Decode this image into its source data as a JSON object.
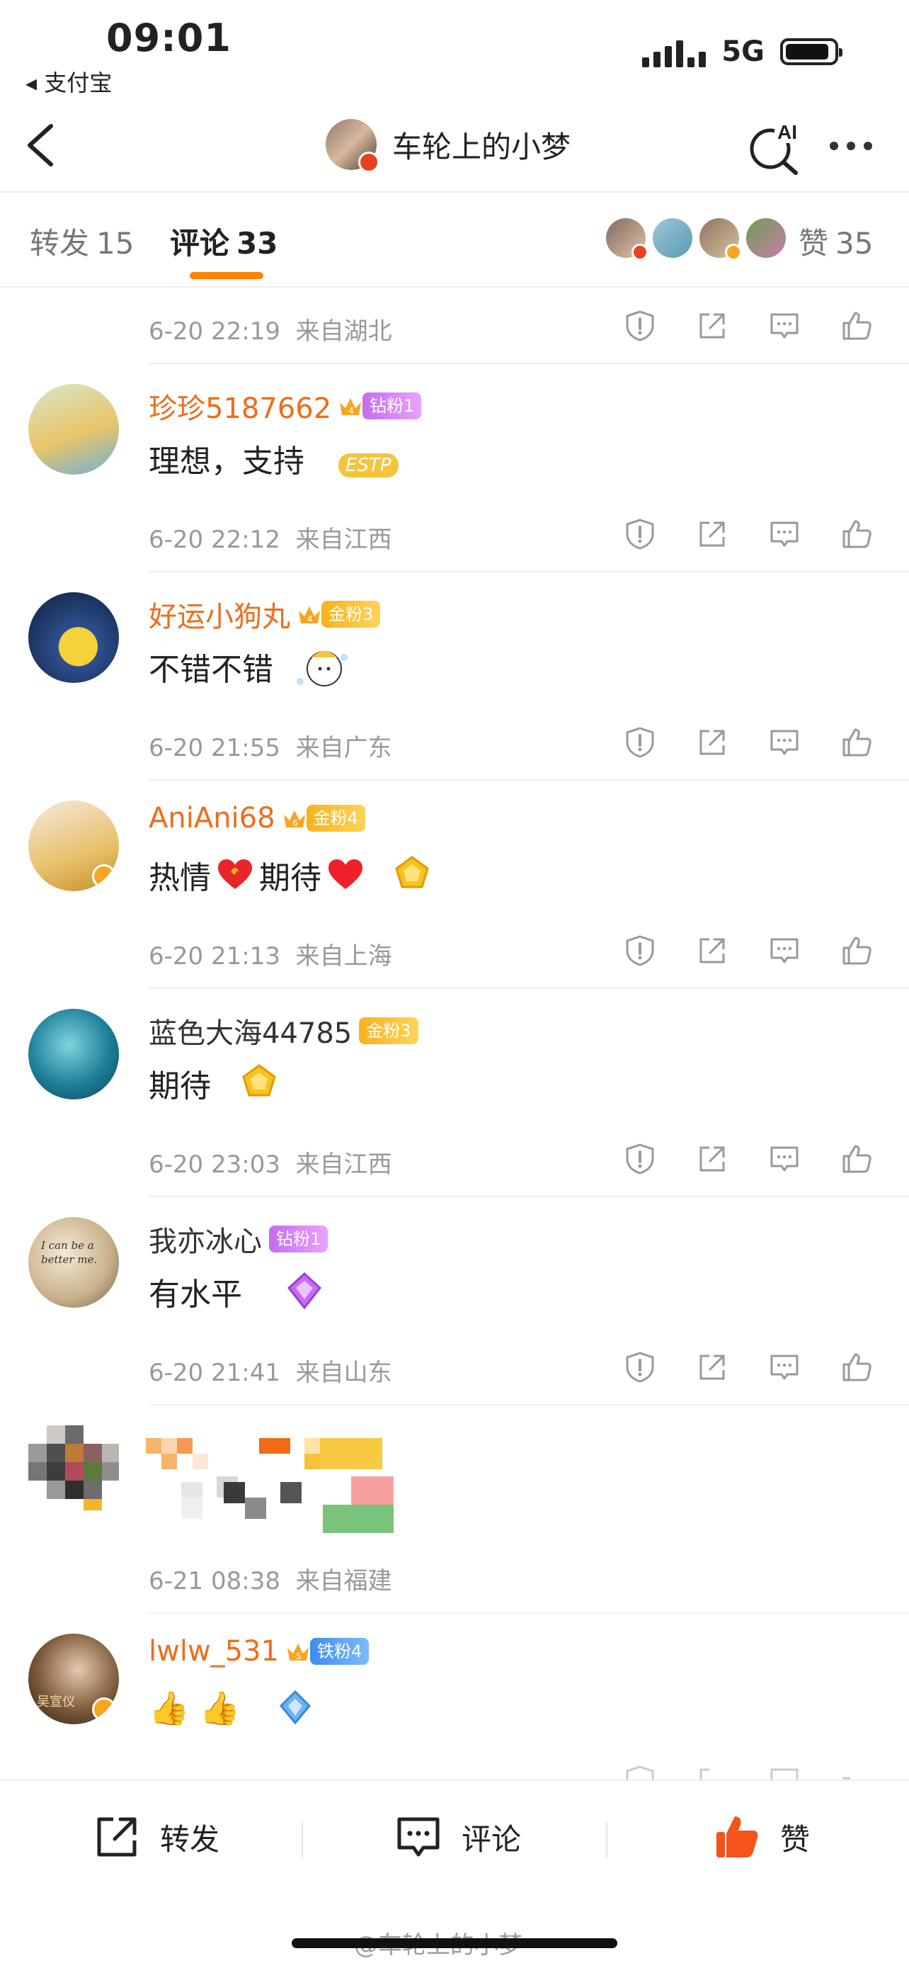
{
  "status_bar": {
    "time": "09:01",
    "back_app": "◂ 支付宝",
    "network": "5G"
  },
  "nav": {
    "title": "车轮上的小梦",
    "ai_label": "AI"
  },
  "tabs": {
    "repost_label": "转发",
    "repost_count": "15",
    "comment_label": "评论",
    "comment_count": "33",
    "like_label": "赞",
    "like_count": "35",
    "accent_color": "#ff8200"
  },
  "comments": [
    {
      "time": "6-20 22:19",
      "location": "来自湖北"
    },
    {
      "name": "珍珍5187662",
      "badge_level": "4",
      "badge": "钻粉1",
      "text": "理想，支持",
      "deco": "ESTP",
      "time": "6-20 22:12",
      "location": "来自江西"
    },
    {
      "name": "好运小狗丸",
      "badge_level": "4",
      "badge": "金粉3",
      "text": "不错不错",
      "time": "6-20 21:55",
      "location": "来自广东"
    },
    {
      "name": "AniAni68",
      "badge_level": "6",
      "badge": "金粉4",
      "text_a": "热情",
      "text_b": "期待",
      "time": "6-20 21:13",
      "location": "来自上海"
    },
    {
      "name": "蓝色大海44785",
      "badge": "金粉3",
      "text": "期待",
      "time": "6-20 23:03",
      "location": "来自江西"
    },
    {
      "name": "我亦冰心",
      "badge": "钻粉1",
      "text": "有水平",
      "avatar_text": "I can be a better me.",
      "time": "6-20 21:41",
      "location": "来自山东"
    },
    {
      "time": "6-21 08:38",
      "location": "来自福建"
    },
    {
      "name": "lwlw_531",
      "badge_level": "5",
      "badge": "铁粉4",
      "avatar_text": "吴宣仪",
      "text": "👍 👍"
    }
  ],
  "bottom_bar": {
    "repost": "转发",
    "comment": "评论",
    "like": "赞"
  },
  "watermark": "@车轮上的小梦"
}
